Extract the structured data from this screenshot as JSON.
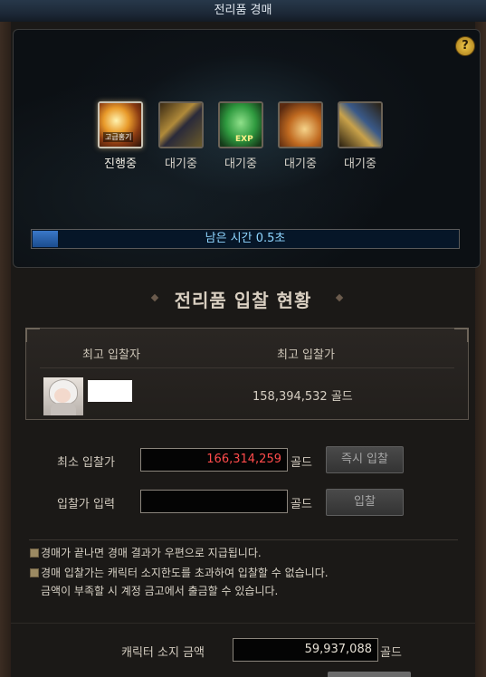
{
  "window": {
    "title": "전리품 경매"
  },
  "help_label": "?",
  "items": [
    {
      "badge": "고급홍기",
      "status": "진행중",
      "active": true
    },
    {
      "status": "대기중"
    },
    {
      "badge": "EXP",
      "status": "대기중"
    },
    {
      "status": "대기중"
    },
    {
      "status": "대기중"
    }
  ],
  "timer": {
    "text": "남은 시간 0.5초",
    "progress": 0.06
  },
  "bid_status": {
    "title": "전리품 입찰 현황",
    "col_bidder": "최고 입찰자",
    "col_price": "최고 입찰가",
    "top_bid": "158,394,532 골드"
  },
  "form": {
    "min_bid_label": "최소 입찰가",
    "min_bid_value": "166,314,259",
    "gold_unit": "골드",
    "instant_bid": "즉시 입찰",
    "bid_input_label": "입찰가 입력",
    "bid_input_value": "",
    "bid_button": "입찰"
  },
  "notes": [
    "경매가 끝나면 경매 결과가 우편으로 지급됩니다.",
    "경매 입찰가는 캐릭터 소지한도를 초과하여 입찰할 수 없습니다.",
    "금액이 부족할 시 계정 금고에서 출금할 수 있습니다."
  ],
  "balance": {
    "label": "캐릭터 소지 금액",
    "value": "59,937,088",
    "unit": "골드"
  },
  "colors": {
    "min_bid": "#ff4b4b",
    "timer_text": "#8fd6ff",
    "accent_gold": "#f0c84a"
  }
}
